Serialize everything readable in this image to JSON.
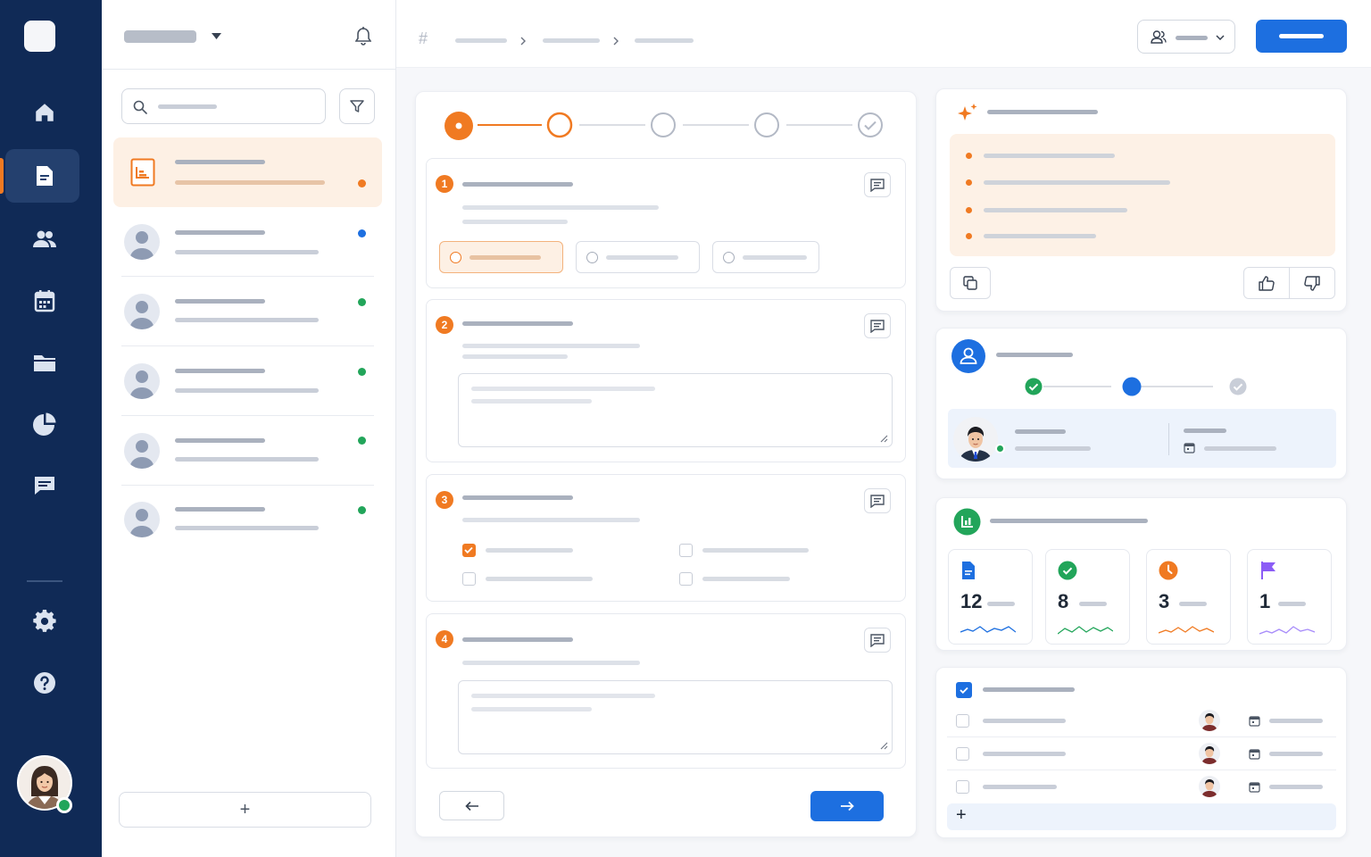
{
  "colors": {
    "rail_bg": "#102a56",
    "accent_orange": "#f07a22",
    "primary_blue": "#1d6fe0",
    "success_green": "#22a55a",
    "flag_purple": "#8b5cf6"
  },
  "rail": {
    "items": [
      {
        "icon": "home-icon",
        "active": false
      },
      {
        "icon": "document-icon",
        "active": true
      },
      {
        "icon": "users-icon",
        "active": false
      },
      {
        "icon": "calendar-icon",
        "active": false
      },
      {
        "icon": "folder-icon",
        "active": false
      },
      {
        "icon": "pie-chart-icon",
        "active": false
      },
      {
        "icon": "chat-icon",
        "active": false
      }
    ],
    "bottom_items": [
      {
        "icon": "gear-icon"
      },
      {
        "icon": "help-icon"
      }
    ]
  },
  "list": {
    "add_label": "+",
    "items": [
      {
        "status": "orange",
        "active": true
      },
      {
        "status": "blue",
        "active": false
      },
      {
        "status": "green",
        "active": false
      },
      {
        "status": "green",
        "active": false
      },
      {
        "status": "green",
        "active": false
      },
      {
        "status": "green",
        "active": false
      }
    ]
  },
  "form": {
    "stepper": {
      "total": 5,
      "current": 1
    },
    "sections": [
      {
        "number": "1",
        "type": "radio-options",
        "options": 3,
        "selected_index": 0
      },
      {
        "number": "2",
        "type": "textarea"
      },
      {
        "number": "3",
        "type": "checkbox-grid",
        "checked": [
          true,
          false,
          false,
          false
        ]
      },
      {
        "number": "4",
        "type": "textarea"
      }
    ]
  },
  "assistant": {
    "icon": "sparkle-icon",
    "bullets": 4
  },
  "workflow": {
    "steps": [
      "done",
      "current",
      "done-muted"
    ]
  },
  "stats": [
    {
      "value": "12",
      "icon": "document-icon",
      "color": "#1d6fe0"
    },
    {
      "value": "8",
      "icon": "check-circle-icon",
      "color": "#22a55a"
    },
    {
      "value": "3",
      "icon": "clock-icon",
      "color": "#f07a22"
    },
    {
      "value": "1",
      "icon": "flag-icon",
      "color": "#8b5cf6"
    }
  ],
  "tasks": {
    "add_label": "+",
    "rows": 3
  }
}
